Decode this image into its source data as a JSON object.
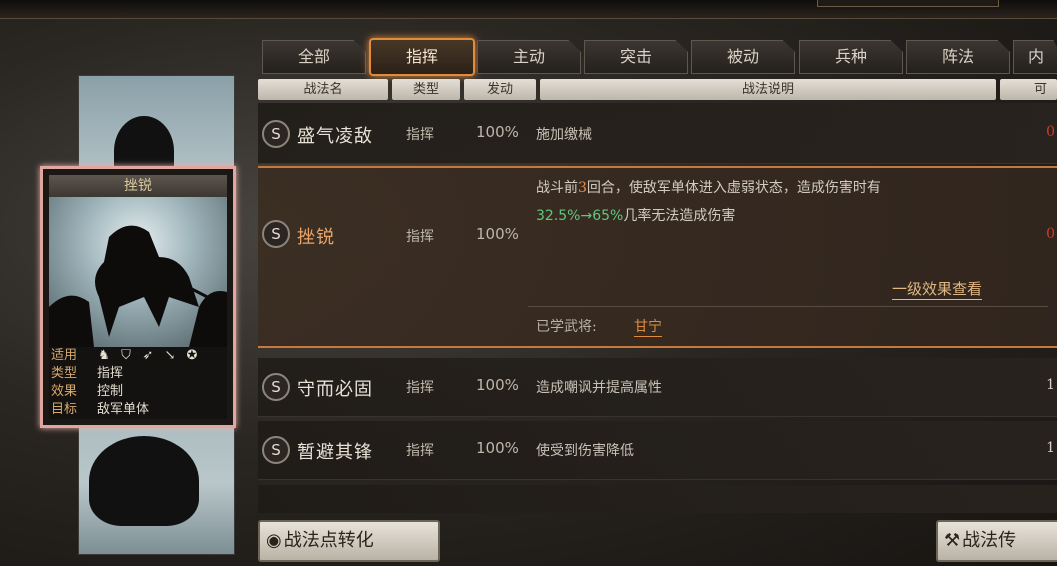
{
  "tabs": [
    {
      "label": "全部"
    },
    {
      "label": "指挥",
      "active": true
    },
    {
      "label": "主动"
    },
    {
      "label": "突击"
    },
    {
      "label": "被动"
    },
    {
      "label": "兵种"
    },
    {
      "label": "阵法"
    },
    {
      "label": "内"
    }
  ],
  "columns": {
    "name": "战法名",
    "type": "类型",
    "trigger": "发动",
    "desc": "战法说明",
    "extra": "可"
  },
  "rows": [
    {
      "grade": "S",
      "name": "盛气凌敌",
      "type": "指挥",
      "rate": "100%",
      "desc": "施加缴械",
      "right": "0"
    },
    {
      "grade": "S",
      "name": "挫锐",
      "type": "指挥",
      "rate": "100%",
      "desc_line1_a": "战斗前",
      "desc_line1_num": "3",
      "desc_line1_b": "回合，使敌军单体进入虚弱状态，造成伤害时有",
      "desc_line2_num": "32.5%→65%",
      "desc_line2_b": "几率无法造成伤害",
      "link": "一级效果查看",
      "learned_label": "已学武将:",
      "learned_value": "甘宁",
      "right": "0"
    },
    {
      "grade": "S",
      "name": "守而必固",
      "type": "指挥",
      "rate": "100%",
      "desc": "造成嘲讽并提高属性",
      "right": "1"
    },
    {
      "grade": "S",
      "name": "暂避其锋",
      "type": "指挥",
      "rate": "100%",
      "desc": "使受到伤害降低",
      "right": "1"
    }
  ],
  "buttons": {
    "convert": "战法点转化",
    "convert_icon": "◉",
    "transfer": "战法传",
    "transfer_icon": "⚒"
  },
  "card": {
    "title": "挫锐",
    "info": [
      {
        "k": "适用",
        "v": ""
      },
      {
        "k": "类型",
        "v": "指挥"
      },
      {
        "k": "效果",
        "v": "控制"
      },
      {
        "k": "目标",
        "v": "敌军单体"
      }
    ],
    "unit_icons": [
      "cavalry-icon",
      "shield-icon",
      "bow-icon",
      "spear-icon",
      "wheel-icon"
    ]
  },
  "colors": {
    "accent": "#e08b3e",
    "selected_name": "#e8a468",
    "highlight_green": "#5fc87d",
    "red_value": "#d23b2c"
  }
}
